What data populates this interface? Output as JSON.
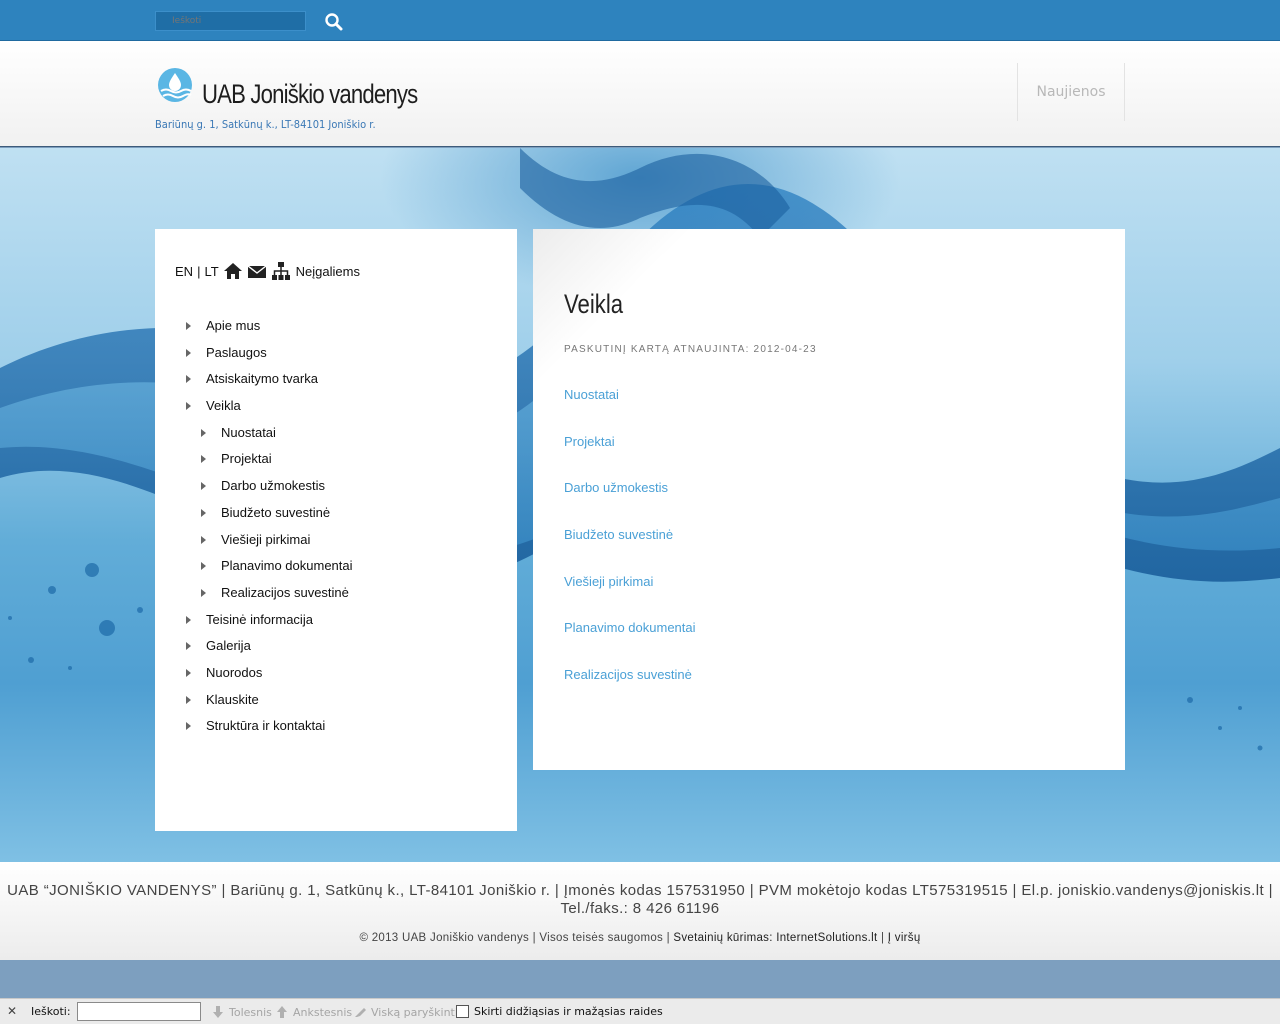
{
  "search": {
    "placeholder": "Ieškoti"
  },
  "header": {
    "company_name": "UAB Joniškio vandenys",
    "address": "Bariūnų g. 1, Satkūnų k., LT-84101 Joniškio r.",
    "news_tab": "Naujienos"
  },
  "sidebar": {
    "lang_en": "EN",
    "lang_sep": "|",
    "lang_lt": "LT",
    "disabled_link": "Neįgaliems",
    "menu": [
      {
        "label": "Apie mus",
        "level": 1
      },
      {
        "label": "Paslaugos",
        "level": 1
      },
      {
        "label": "Atsiskaitymo tvarka",
        "level": 1
      },
      {
        "label": "Veikla",
        "level": 1
      },
      {
        "label": "Nuostatai",
        "level": 2
      },
      {
        "label": "Projektai",
        "level": 2
      },
      {
        "label": "Darbo užmokestis",
        "level": 2
      },
      {
        "label": "Biudžeto suvestinė",
        "level": 2
      },
      {
        "label": "Viešieji pirkimai",
        "level": 2
      },
      {
        "label": "Planavimo dokumentai",
        "level": 2
      },
      {
        "label": "Realizacijos suvestinė",
        "level": 2
      },
      {
        "label": "Teisinė informacija",
        "level": 1
      },
      {
        "label": "Galerija",
        "level": 1
      },
      {
        "label": "Nuorodos",
        "level": 1
      },
      {
        "label": "Klauskite",
        "level": 1
      },
      {
        "label": "Struktūra ir kontaktai",
        "level": 1
      }
    ]
  },
  "content": {
    "title": "Veikla",
    "updated": "PASKUTINĮ KARTĄ ATNAUJINTA: 2012-04-23",
    "links": [
      "Nuostatai",
      "Projektai",
      "Darbo užmokestis",
      "Biudžeto suvestinė",
      "Viešieji pirkimai",
      "Planavimo dokumentai",
      "Realizacijos suvestinė"
    ]
  },
  "footer": {
    "info": "UAB “JONIŠKIO VANDENYS” | Bariūnų g. 1, Satkūnų k., LT-84101 Joniškio r. | Įmonės kodas 157531950 | PVM mokėtojo kodas LT575319515 | El.p. joniskio.vandenys@joniskis.lt | Tel./faks.: 8 426 61196",
    "copyright": "© 2013 UAB Joniškio vandenys | Visos teisės saugomos |",
    "dev_label": "Svetainių kūrimas:",
    "dev_link": "InternetSolutions.lt",
    "sep": "|",
    "top_link": "Į viršų"
  },
  "findbar": {
    "close": "✕",
    "label": "Ieškoti:",
    "next": "Tolesnis",
    "prev": "Ankstesnis",
    "highlight": "Viską paryškinti",
    "match_case": "Skirti didžiąsias ir mažąsias raides"
  },
  "colors": {
    "topbar": "#2e83be",
    "link": "#4aa0d6",
    "address": "#3a78b5"
  }
}
